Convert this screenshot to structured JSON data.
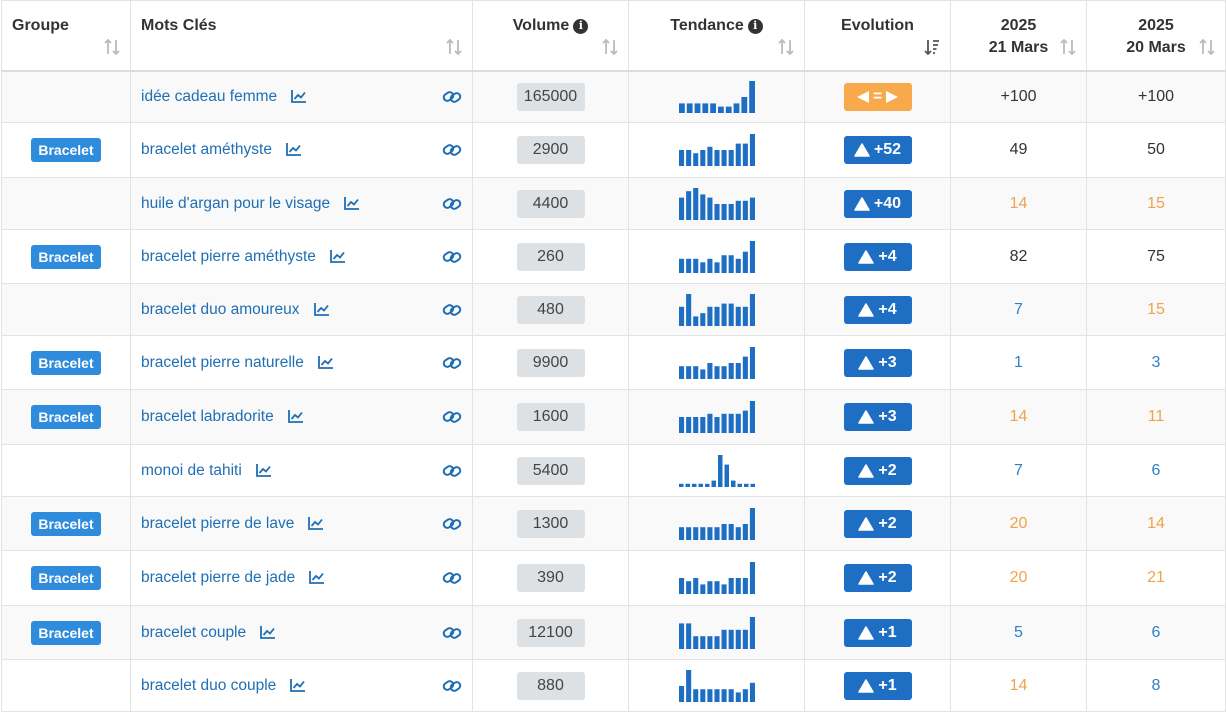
{
  "colors": {
    "link": "#1f6fb5",
    "badge": "#2f8bdb",
    "evolution_up": "#1e6fc4",
    "evolution_same": "#f7a94b",
    "rank_good": "#2f7fc1",
    "rank_mid": "#f0a34a",
    "rank_neutral": "#333333",
    "spark_bar": "#1e6fc4"
  },
  "header": {
    "groupe": "Groupe",
    "mots_cles": "Mots Clés",
    "volume": "Volume",
    "tendance": "Tendance",
    "evolution": "Evolution",
    "date1_year": "2025",
    "date1_day": "21 Mars",
    "date2_year": "2025",
    "date2_day": "20 Mars",
    "info_icon": "i"
  },
  "rows": [
    {
      "group": "",
      "keyword": "idée cadeau femme",
      "volume": "165000",
      "trend": [
        3,
        3,
        3,
        3,
        3,
        2,
        2,
        3,
        5,
        10
      ],
      "evolution": "=",
      "evo_type": "same",
      "rank1": "+100",
      "rank1_color": "neutral",
      "rank2": "+100",
      "rank2_color": "neutral"
    },
    {
      "group": "Bracelet",
      "keyword": "bracelet améthyste",
      "volume": "2900",
      "trend": [
        5,
        5,
        4,
        5,
        6,
        5,
        5,
        5,
        7,
        7,
        10
      ],
      "evolution": "+52",
      "evo_type": "up",
      "rank1": "49",
      "rank1_color": "neutral",
      "rank2": "50",
      "rank2_color": "neutral"
    },
    {
      "group": "",
      "keyword": "huile d'argan pour le visage",
      "volume": "4400",
      "trend": [
        7,
        9,
        10,
        8,
        7,
        5,
        5,
        5,
        6,
        6,
        7
      ],
      "evolution": "+40",
      "evo_type": "up",
      "rank1": "14",
      "rank1_color": "mid",
      "rank2": "15",
      "rank2_color": "mid"
    },
    {
      "group": "Bracelet",
      "keyword": "bracelet pierre améthyste",
      "volume": "260",
      "trend": [
        4,
        4,
        4,
        3,
        4,
        3,
        5,
        5,
        4,
        6,
        9
      ],
      "evolution": "+4",
      "evo_type": "up",
      "rank1": "82",
      "rank1_color": "neutral",
      "rank2": "75",
      "rank2_color": "neutral"
    },
    {
      "group": "",
      "keyword": "bracelet duo amoureux",
      "volume": "480",
      "trend": [
        6,
        10,
        3,
        4,
        6,
        6,
        7,
        7,
        6,
        6,
        10
      ],
      "evolution": "+4",
      "evo_type": "up",
      "rank1": "7",
      "rank1_color": "good",
      "rank2": "15",
      "rank2_color": "mid"
    },
    {
      "group": "Bracelet",
      "keyword": "bracelet pierre naturelle",
      "volume": "9900",
      "trend": [
        4,
        4,
        4,
        3,
        5,
        4,
        4,
        5,
        5,
        7,
        10
      ],
      "evolution": "+3",
      "evo_type": "up",
      "rank1": "1",
      "rank1_color": "good",
      "rank2": "3",
      "rank2_color": "good"
    },
    {
      "group": "Bracelet",
      "keyword": "bracelet labradorite",
      "volume": "1600",
      "trend": [
        5,
        5,
        5,
        5,
        6,
        5,
        6,
        6,
        6,
        7,
        10
      ],
      "evolution": "+3",
      "evo_type": "up",
      "rank1": "14",
      "rank1_color": "mid",
      "rank2": "11",
      "rank2_color": "mid"
    },
    {
      "group": "",
      "keyword": "monoi de tahiti",
      "volume": "5400",
      "trend": [
        1,
        1,
        1,
        1,
        1,
        2,
        10,
        7,
        2,
        1,
        1,
        1
      ],
      "evolution": "+2",
      "evo_type": "up",
      "rank1": "7",
      "rank1_color": "good",
      "rank2": "6",
      "rank2_color": "good"
    },
    {
      "group": "Bracelet",
      "keyword": "bracelet pierre de lave",
      "volume": "1300",
      "trend": [
        4,
        4,
        4,
        4,
        4,
        4,
        5,
        5,
        4,
        5,
        10
      ],
      "evolution": "+2",
      "evo_type": "up",
      "rank1": "20",
      "rank1_color": "mid",
      "rank2": "14",
      "rank2_color": "mid"
    },
    {
      "group": "Bracelet",
      "keyword": "bracelet pierre de jade",
      "volume": "390",
      "trend": [
        5,
        4,
        5,
        3,
        4,
        4,
        3,
        5,
        5,
        5,
        10
      ],
      "evolution": "+2",
      "evo_type": "up",
      "rank1": "20",
      "rank1_color": "mid",
      "rank2": "21",
      "rank2_color": "mid"
    },
    {
      "group": "Bracelet",
      "keyword": "bracelet couple",
      "volume": "12100",
      "trend": [
        8,
        8,
        4,
        4,
        4,
        4,
        6,
        6,
        6,
        6,
        10
      ],
      "evolution": "+1",
      "evo_type": "up",
      "rank1": "5",
      "rank1_color": "good",
      "rank2": "6",
      "rank2_color": "good"
    },
    {
      "group": "",
      "keyword": "bracelet duo couple",
      "volume": "880",
      "trend": [
        5,
        10,
        4,
        4,
        4,
        4,
        4,
        4,
        3,
        4,
        6
      ],
      "evolution": "+1",
      "evo_type": "up",
      "rank1": "14",
      "rank1_color": "mid",
      "rank2": "8",
      "rank2_color": "good"
    }
  ]
}
